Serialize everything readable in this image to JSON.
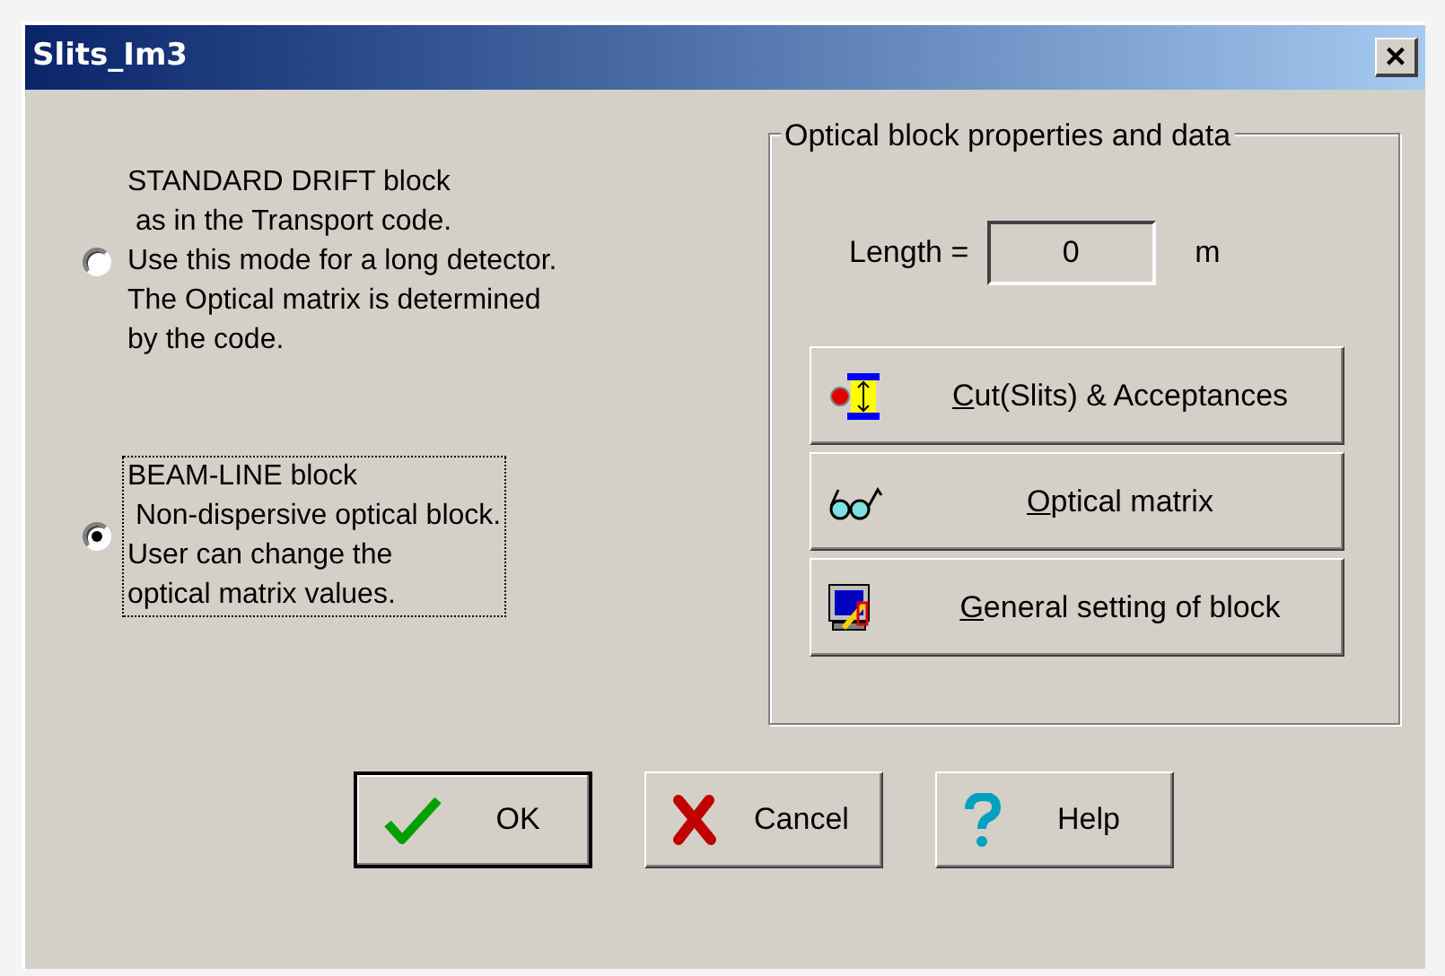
{
  "window": {
    "title": "Slits_Im3",
    "close_button": "×"
  },
  "modes": [
    {
      "lines": [
        "STANDARD DRIFT block",
        " as in the Transport code.",
        "Use this mode for a long detector.",
        "The Optical matrix is determined",
        "by the code."
      ],
      "selected": false,
      "focused": false
    },
    {
      "lines": [
        "BEAM-LINE block",
        " Non-dispersive optical block.",
        "User can change the",
        "optical matrix values."
      ],
      "selected": true,
      "focused": true
    }
  ],
  "properties": {
    "title": "Optical block properties and data",
    "length_label": "Length =",
    "length_value": "0",
    "length_unit": "m",
    "buttons": [
      {
        "kind": "cut",
        "label": "Cut(Slits) & Acceptances",
        "mnemonic": true
      },
      {
        "kind": "glasses",
        "label": "Optical matrix",
        "mnemonic": true
      },
      {
        "kind": "computer",
        "label": "General setting of block",
        "mnemonic": true
      }
    ]
  },
  "dialog_buttons": [
    {
      "kind": "ok",
      "label": "OK",
      "default": true
    },
    {
      "kind": "cancel",
      "label": "Cancel",
      "default": false
    },
    {
      "kind": "help",
      "label": "Help",
      "default": false
    }
  ]
}
